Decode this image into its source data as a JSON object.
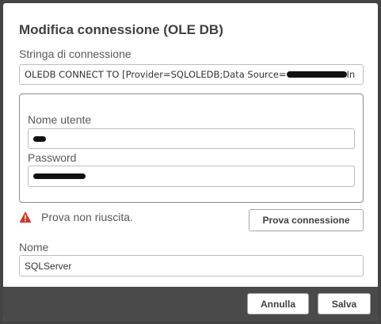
{
  "dialog": {
    "title": "Modifica connessione (OLE DB)",
    "connection_string": {
      "label": "Stringa di connessione",
      "value_visible_prefix": "OLEDB CONNECT TO [Provider=SQLOLEDB;Data Source=",
      "value_visible_suffix": "In"
    },
    "credentials": {
      "username_label": "Nome utente",
      "password_label": "Password"
    },
    "status": {
      "icon": "warning-icon",
      "text": "Prova non riuscita.",
      "color": "#d93025"
    },
    "test_button_label": "Prova connessione",
    "name": {
      "label": "Nome",
      "value": "SQLServer"
    },
    "footer": {
      "cancel_label": "Annulla",
      "save_label": "Salva"
    }
  }
}
